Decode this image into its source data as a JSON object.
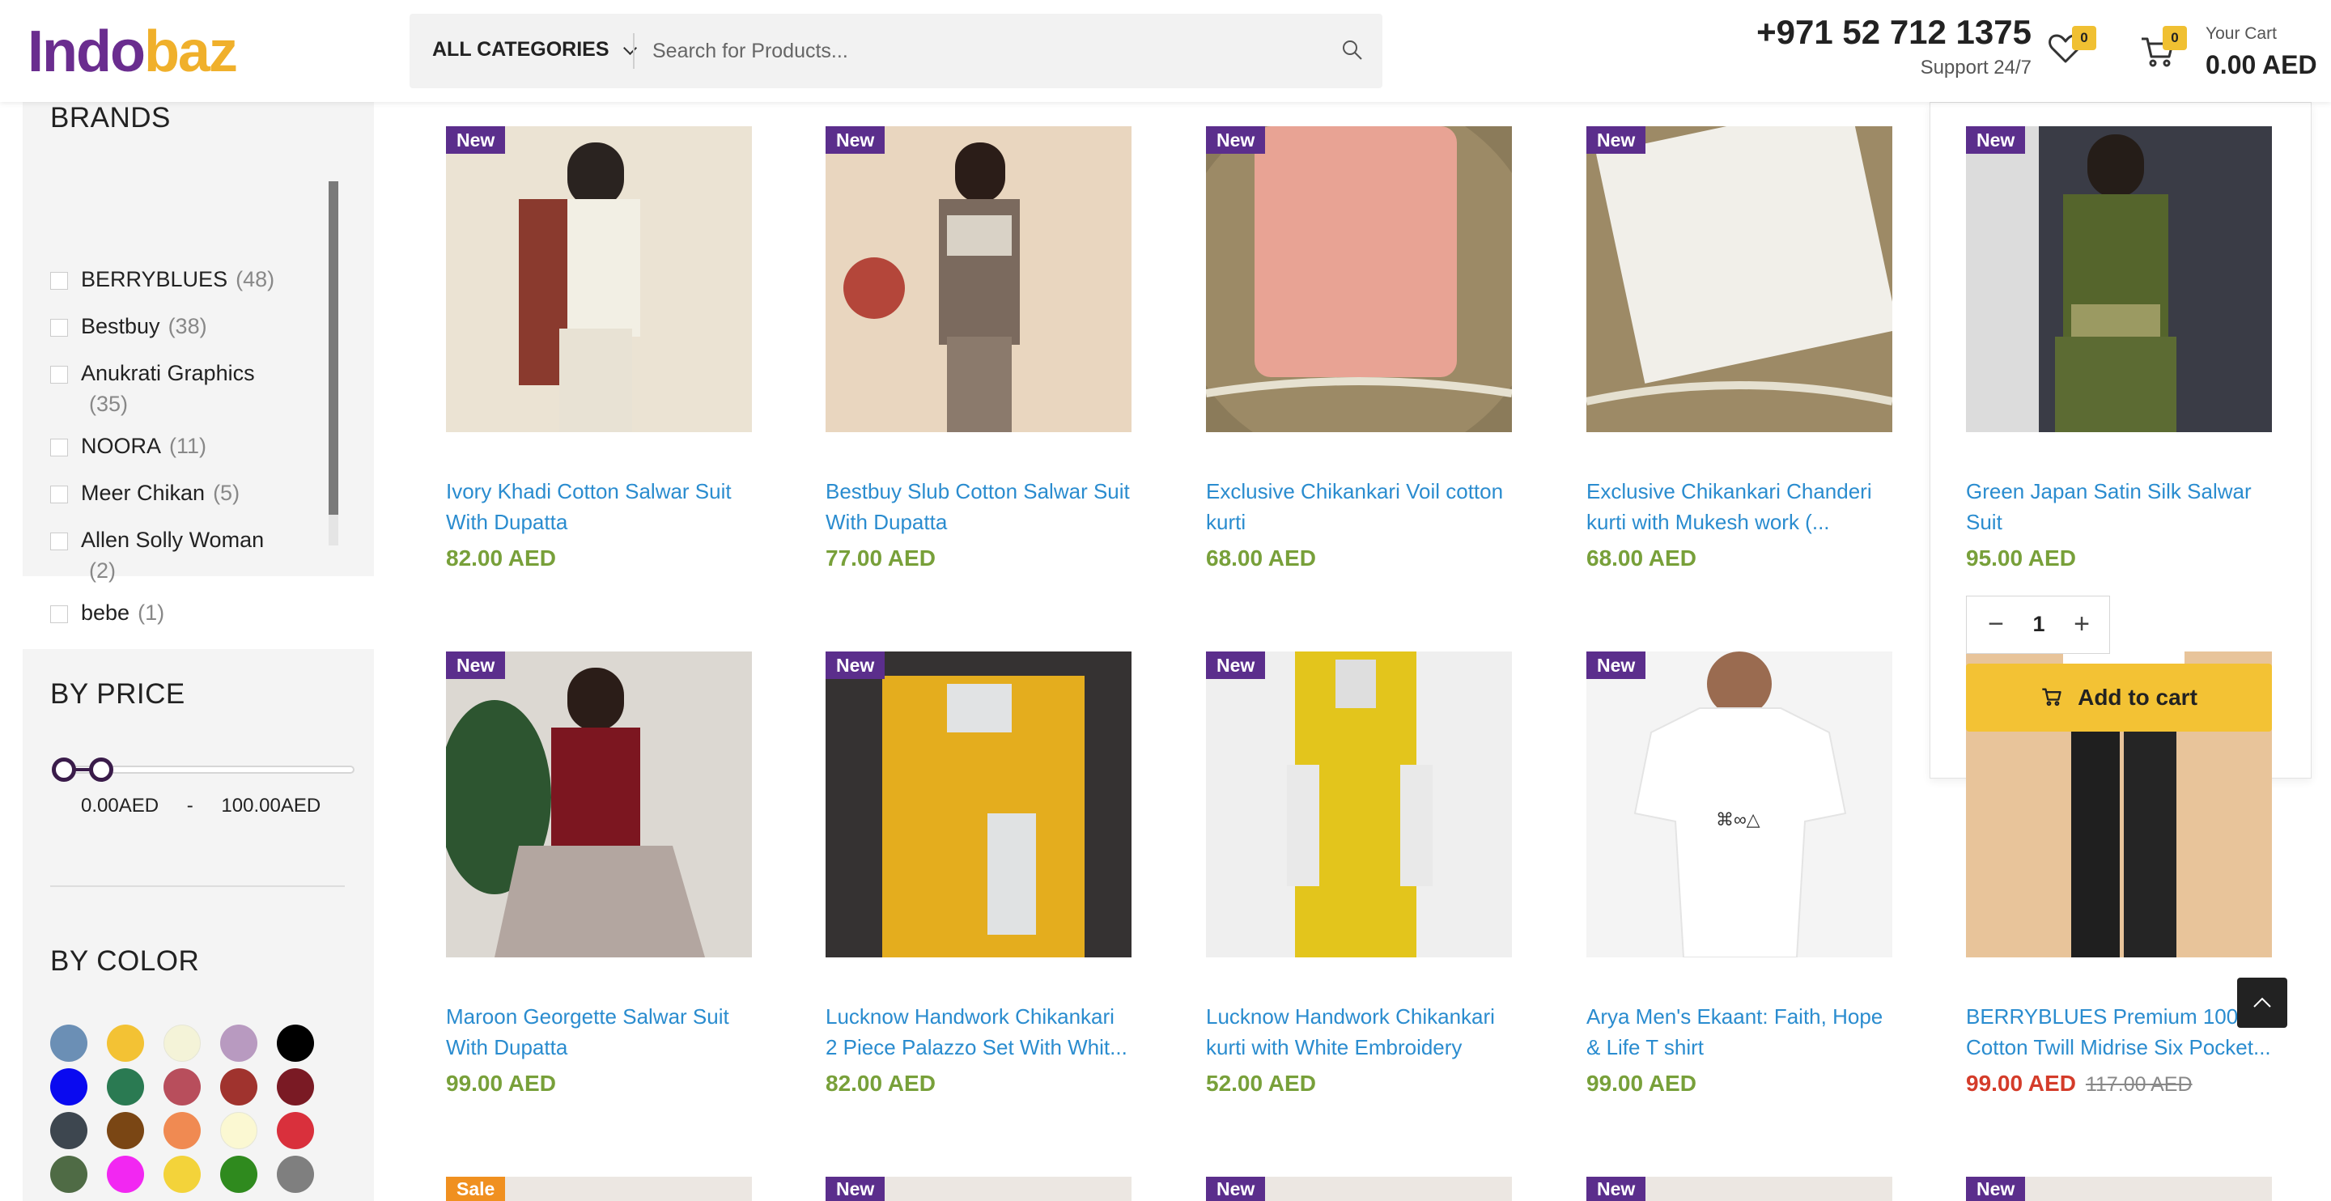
{
  "header": {
    "logo_part1": "Indo",
    "logo_part2": "baz",
    "category_label": "ALL CATEGORIES",
    "search_placeholder": "Search for Products...",
    "phone": "+971 52 712 1375",
    "support": "Support 24/7",
    "wishlist_count": "0",
    "cart_count": "0",
    "cart_label": "Your Cart",
    "cart_total": "0.00 AED"
  },
  "sidebar": {
    "brands_title": "BRANDS",
    "brands": [
      {
        "name": "BERRYBLUES",
        "count": "(48)"
      },
      {
        "name": "Bestbuy",
        "count": "(38)"
      },
      {
        "name": "Anukrati Graphics",
        "count": "(35)"
      },
      {
        "name": "NOORA",
        "count": "(11)"
      },
      {
        "name": "Meer Chikan",
        "count": "(5)"
      },
      {
        "name": "Allen Solly Woman",
        "count": "(2)"
      },
      {
        "name": "bebe",
        "count": "(1)"
      }
    ],
    "price_title": "BY PRICE",
    "price_min": "0.00AED",
    "price_sep": "-",
    "price_max": "100.00AED",
    "color_title": "BY COLOR",
    "colors": [
      "#6b8fb5",
      "#f3c234",
      "#f4f3d8",
      "#b89ac0",
      "#000000",
      "#0a0af0",
      "#2a7a52",
      "#b84e5c",
      "#a0332e",
      "#7a1a24",
      "#3d464f",
      "#7a4614",
      "#f08a52",
      "#fbf8d2",
      "#d9303c",
      "#4f6b45",
      "#f227f2",
      "#f3d33a",
      "#2f8a1e",
      "#7f7f7f"
    ]
  },
  "products": [
    {
      "tag": "New",
      "title": "Ivory Khadi Cotton Salwar Suit With Dupatta",
      "price": "82.00 AED"
    },
    {
      "tag": "New",
      "title": "Bestbuy Slub Cotton Salwar Suit With Dupatta",
      "price": "77.00 AED"
    },
    {
      "tag": "New",
      "title": "Exclusive Chikankari Voil cotton kurti",
      "price": "68.00 AED"
    },
    {
      "tag": "New",
      "title": "Exclusive Chikankari Chanderi kurti with Mukesh work (...",
      "price": "68.00 AED"
    },
    {
      "tag": "New",
      "title": "Green Japan Satin Silk Salwar Suit",
      "price": "95.00 AED"
    },
    {
      "tag": "New",
      "title": "Maroon Georgette Salwar Suit With Dupatta",
      "price": "99.00 AED"
    },
    {
      "tag": "New",
      "title": "Lucknow Handwork Chikankari 2 Piece Palazzo Set With Whit...",
      "price": "82.00 AED"
    },
    {
      "tag": "New",
      "title": "Lucknow Handwork Chikankari kurti with White Embroidery",
      "price": "52.00 AED"
    },
    {
      "tag": "New",
      "title": "Arya Men's Ekaant: Faith, Hope & Life T shirt",
      "price": "99.00 AED"
    },
    {
      "tag": "",
      "title": "BERRYBLUES Premium 100% Cotton Twill Midrise Six Pocket...",
      "price": "99.00 AED",
      "old_price": "117.00 AED"
    }
  ],
  "next_row_tags": [
    "Sale",
    "New",
    "New",
    "New",
    "New"
  ],
  "quick_add": {
    "quantity": "1",
    "add_label": "Add to cart"
  }
}
